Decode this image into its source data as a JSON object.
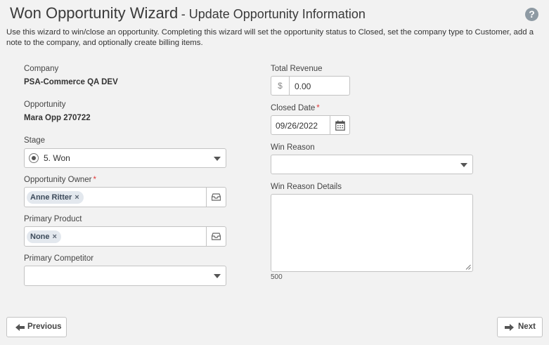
{
  "header": {
    "title": "Won Opportunity Wizard",
    "subtitle": "- Update Opportunity Information",
    "help_icon": "?",
    "description": "Use this wizard to win/close an opportunity. Completing this wizard will set the opportunity status to Closed, set the company type to Customer, add a note to the company, and optionally create billing items."
  },
  "left": {
    "company_label": "Company",
    "company_value": "PSA-Commerce QA DEV",
    "opportunity_label": "Opportunity",
    "opportunity_value": "Mara Opp 270722",
    "stage_label": "Stage",
    "stage_value": "5. Won",
    "owner_label": "Opportunity Owner",
    "owner_tag": "Anne Ritter",
    "product_label": "Primary Product",
    "product_tag": "None",
    "competitor_label": "Primary Competitor",
    "competitor_value": "",
    "tag_remove": "×",
    "required_mark": "*"
  },
  "right": {
    "revenue_label": "Total Revenue",
    "currency_symbol": "$",
    "revenue_value": "0.00",
    "closed_date_label": "Closed Date",
    "closed_date_value": "09/26/2022",
    "win_reason_label": "Win Reason",
    "win_reason_value": "",
    "win_reason_details_label": "Win Reason Details",
    "win_reason_details_value": "",
    "char_counter": "500"
  },
  "footer": {
    "previous_label": "Previous",
    "next_label": "Next"
  },
  "colors": {
    "background": "#f2f2f2",
    "required": "#e03a3a",
    "help_icon": "#8e9aa3",
    "tag_bg": "#e3e8ee"
  },
  "icons": [
    "help-icon",
    "radio-icon",
    "chevron-down-icon",
    "picker-icon",
    "calendar-icon",
    "arrow-left-icon",
    "arrow-right-icon"
  ]
}
